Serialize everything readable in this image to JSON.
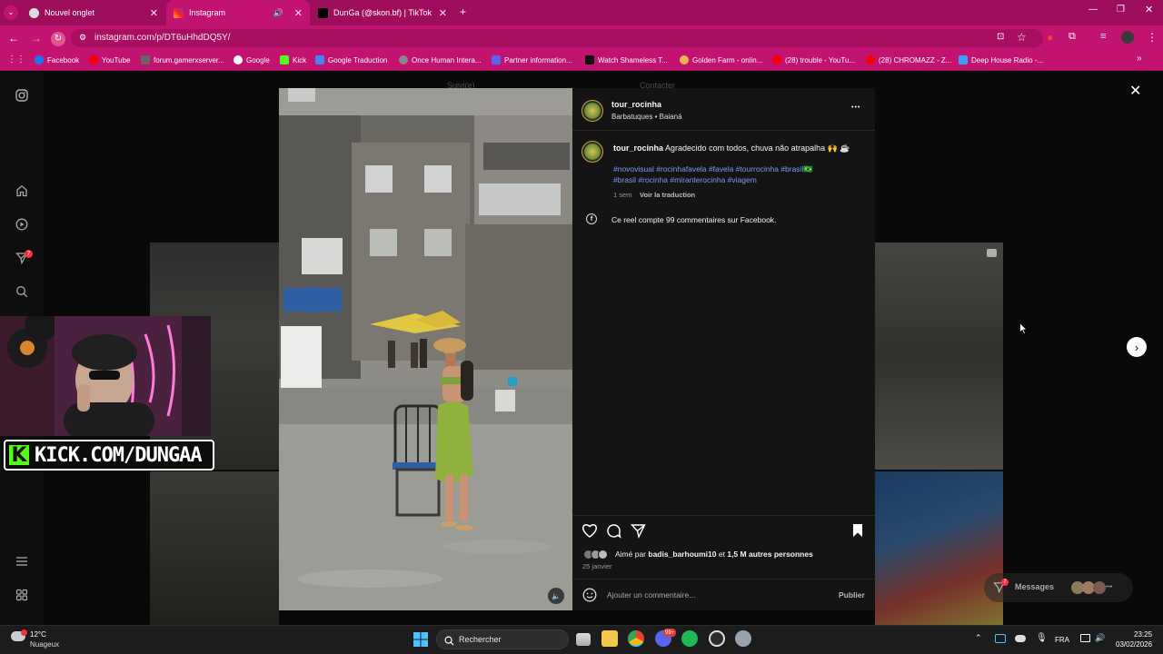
{
  "browser": {
    "tabs": [
      {
        "title": "Nouvel onglet",
        "active": false
      },
      {
        "title": "Instagram",
        "active": true
      },
      {
        "title": "DunGa (@skon.bf) | TikTok",
        "active": false
      }
    ],
    "url": "instagram.com/p/DT6uHhdDQ5Y/",
    "bookmarks": [
      {
        "label": "Facebook",
        "color": "#1877f2"
      },
      {
        "label": "YouTube",
        "color": "#ff0000"
      },
      {
        "label": "forum.gamerxserver...",
        "color": "#555555"
      },
      {
        "label": "Google",
        "color": "#ffffff"
      },
      {
        "label": "Kick",
        "color": "#53fc18"
      },
      {
        "label": "Google Traduction",
        "color": "#4285f4"
      },
      {
        "label": "Once Human Intera...",
        "color": "#777777"
      },
      {
        "label": "Partner information...",
        "color": "#5865f2"
      },
      {
        "label": "Watch Shameless T...",
        "color": "#222222"
      },
      {
        "label": "Golden Farm - onlin...",
        "color": "#e8b84a"
      },
      {
        "label": "(28) trouble - YouTu...",
        "color": "#ff0000"
      },
      {
        "label": "(28) CHROMAZZ - Z...",
        "color": "#ff0000"
      },
      {
        "label": "Deep House Radio -...",
        "color": "#3aa0ff"
      }
    ]
  },
  "instagram": {
    "behind_text": {
      "left": "Suivi(e)",
      "right": "Contacter"
    },
    "post": {
      "author": "tour_rocinha",
      "location": "Barbatuques • Baianá",
      "caption_user": "tour_rocinha",
      "caption": "Agradecido com todos, chuva não atrapalha 🙌 ☕",
      "hashtags_line1": "#novovisual #rocinhafavela #favela #tourrocinha #brasil🇧🇷",
      "hashtags_line2": "#brasil #rocinha #miranterocinha #viagem",
      "age": "1 sem",
      "translate": "Voir la traduction",
      "facebook_note": "Ce reel compte 99 commentaires sur Facebook.",
      "liked_by_prefix": "Aimé par",
      "liked_by_user": "badis_barhoumi10",
      "liked_by_and": "et",
      "liked_by_others": "1,5 M autres personnes",
      "date": "25 janvier",
      "comment_placeholder": "Ajouter un commentaire...",
      "publish": "Publier",
      "more": "•••"
    },
    "messages_label": "Messages",
    "notification_count": "7",
    "messages_count": "7"
  },
  "stream": {
    "kick_text": "KICK.COM/DUNGAA"
  },
  "taskbar": {
    "weather_temp": "12°C",
    "weather_desc": "Nuageux",
    "search_placeholder": "Rechercher",
    "lang": "FRA",
    "time": "23:25",
    "date": "03/02/2026",
    "badge_count": "99+"
  }
}
